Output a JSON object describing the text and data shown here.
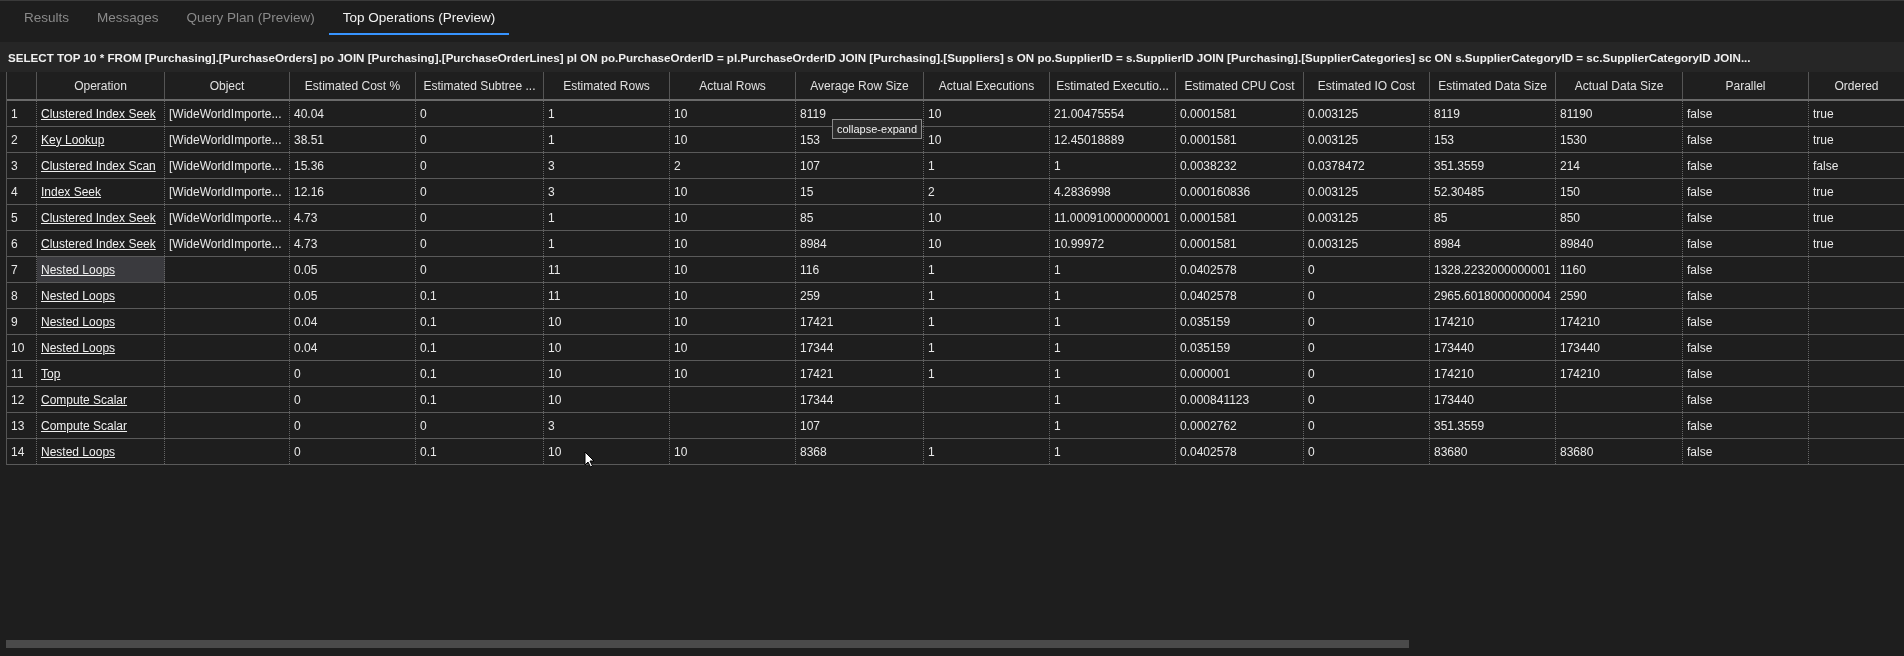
{
  "tabs": [
    {
      "label": "Results",
      "selected": false
    },
    {
      "label": "Messages",
      "selected": false
    },
    {
      "label": "Query Plan (Preview)",
      "selected": false
    },
    {
      "label": "Top Operations (Preview)",
      "selected": true
    }
  ],
  "query": "SELECT TOP 10 * FROM [Purchasing].[PurchaseOrders] po JOIN [Purchasing].[PurchaseOrderLines] pl ON po.PurchaseOrderID = pl.PurchaseOrderID JOIN [Purchasing].[Suppliers] s ON po.SupplierID = s.SupplierID JOIN [Purchasing].[SupplierCategories] sc ON s.SupplierCategoryID = sc.SupplierCategoryID JOIN...",
  "table": {
    "columns": [
      "Operation",
      "Object",
      "Estimated Cost %",
      "Estimated Subtree ...",
      "Estimated Rows",
      "Actual Rows",
      "Average Row Size",
      "Actual Executions",
      "Estimated Executio...",
      "Estimated CPU Cost",
      "Estimated IO Cost",
      "Estimated Data Size",
      "Actual Data Size",
      "Parallel",
      "Ordered"
    ],
    "rows": [
      {
        "number": "1",
        "selected": false,
        "cells": [
          "Clustered Index Seek",
          "[WideWorldImporte...",
          "40.04",
          "0",
          "1",
          "10",
          "8119",
          "10",
          "21.00475554",
          "0.0001581",
          "0.003125",
          "8119",
          "81190",
          "false",
          "true"
        ]
      },
      {
        "number": "2",
        "selected": false,
        "cells": [
          "Key Lookup",
          "[WideWorldImporte...",
          "38.51",
          "0",
          "1",
          "10",
          "153",
          "10",
          "12.45018889",
          "0.0001581",
          "0.003125",
          "153",
          "1530",
          "false",
          "true"
        ]
      },
      {
        "number": "3",
        "selected": false,
        "cells": [
          "Clustered Index Scan",
          "[WideWorldImporte...",
          "15.36",
          "0",
          "3",
          "2",
          "107",
          "1",
          "1",
          "0.0038232",
          "0.0378472",
          "351.3559",
          "214",
          "false",
          "false"
        ]
      },
      {
        "number": "4",
        "selected": false,
        "cells": [
          "Index Seek",
          "[WideWorldImporte...",
          "12.16",
          "0",
          "3",
          "10",
          "15",
          "2",
          "4.2836998",
          "0.000160836",
          "0.003125",
          "52.30485",
          "150",
          "false",
          "true"
        ]
      },
      {
        "number": "5",
        "selected": false,
        "cells": [
          "Clustered Index Seek",
          "[WideWorldImporte...",
          "4.73",
          "0",
          "1",
          "10",
          "85",
          "10",
          "11.000910000000001",
          "0.0001581",
          "0.003125",
          "85",
          "850",
          "false",
          "true"
        ]
      },
      {
        "number": "6",
        "selected": false,
        "cells": [
          "Clustered Index Seek",
          "[WideWorldImporte...",
          "4.73",
          "0",
          "1",
          "10",
          "8984",
          "10",
          "10.99972",
          "0.0001581",
          "0.003125",
          "8984",
          "89840",
          "false",
          "true"
        ]
      },
      {
        "number": "7",
        "selected": true,
        "cells": [
          "Nested Loops",
          null,
          "0.05",
          "0",
          "11",
          "10",
          "116",
          "1",
          "1",
          "0.0402578",
          "0",
          "1328.2232000000001",
          "1160",
          "false",
          null
        ]
      },
      {
        "number": "8",
        "selected": false,
        "cells": [
          "Nested Loops",
          null,
          "0.05",
          "0.1",
          "11",
          "10",
          "259",
          "1",
          "1",
          "0.0402578",
          "0",
          "2965.6018000000004",
          "2590",
          "false",
          null
        ]
      },
      {
        "number": "9",
        "selected": false,
        "cells": [
          "Nested Loops",
          null,
          "0.04",
          "0.1",
          "10",
          "10",
          "17421",
          "1",
          "1",
          "0.035159",
          "0",
          "174210",
          "174210",
          "false",
          null
        ]
      },
      {
        "number": "10",
        "selected": false,
        "cells": [
          "Nested Loops",
          null,
          "0.04",
          "0.1",
          "10",
          "10",
          "17344",
          "1",
          "1",
          "0.035159",
          "0",
          "173440",
          "173440",
          "false",
          null
        ]
      },
      {
        "number": "11",
        "selected": false,
        "cells": [
          "Top",
          null,
          "0",
          "0.1",
          "10",
          "10",
          "17421",
          "1",
          "1",
          "0.000001",
          "0",
          "174210",
          "174210",
          "false",
          null
        ]
      },
      {
        "number": "12",
        "selected": false,
        "cells": [
          "Compute Scalar",
          null,
          "0",
          "0.1",
          "10",
          null,
          "17344",
          null,
          "1",
          "0.000841123",
          "0",
          "173440",
          null,
          "false",
          null
        ]
      },
      {
        "number": "13",
        "selected": false,
        "cells": [
          "Compute Scalar",
          null,
          "0",
          "0",
          "3",
          null,
          "107",
          null,
          "1",
          "0.0002762",
          "0",
          "351.3559",
          null,
          "false",
          null
        ]
      },
      {
        "number": "14",
        "selected": false,
        "cells": [
          "Nested Loops",
          null,
          "0",
          "0.1",
          "10",
          "10",
          "8368",
          "1",
          "1",
          "0.0402578",
          "0",
          "83680",
          "83680",
          "false",
          null
        ]
      }
    ]
  },
  "tooltip": "collapse-expand"
}
